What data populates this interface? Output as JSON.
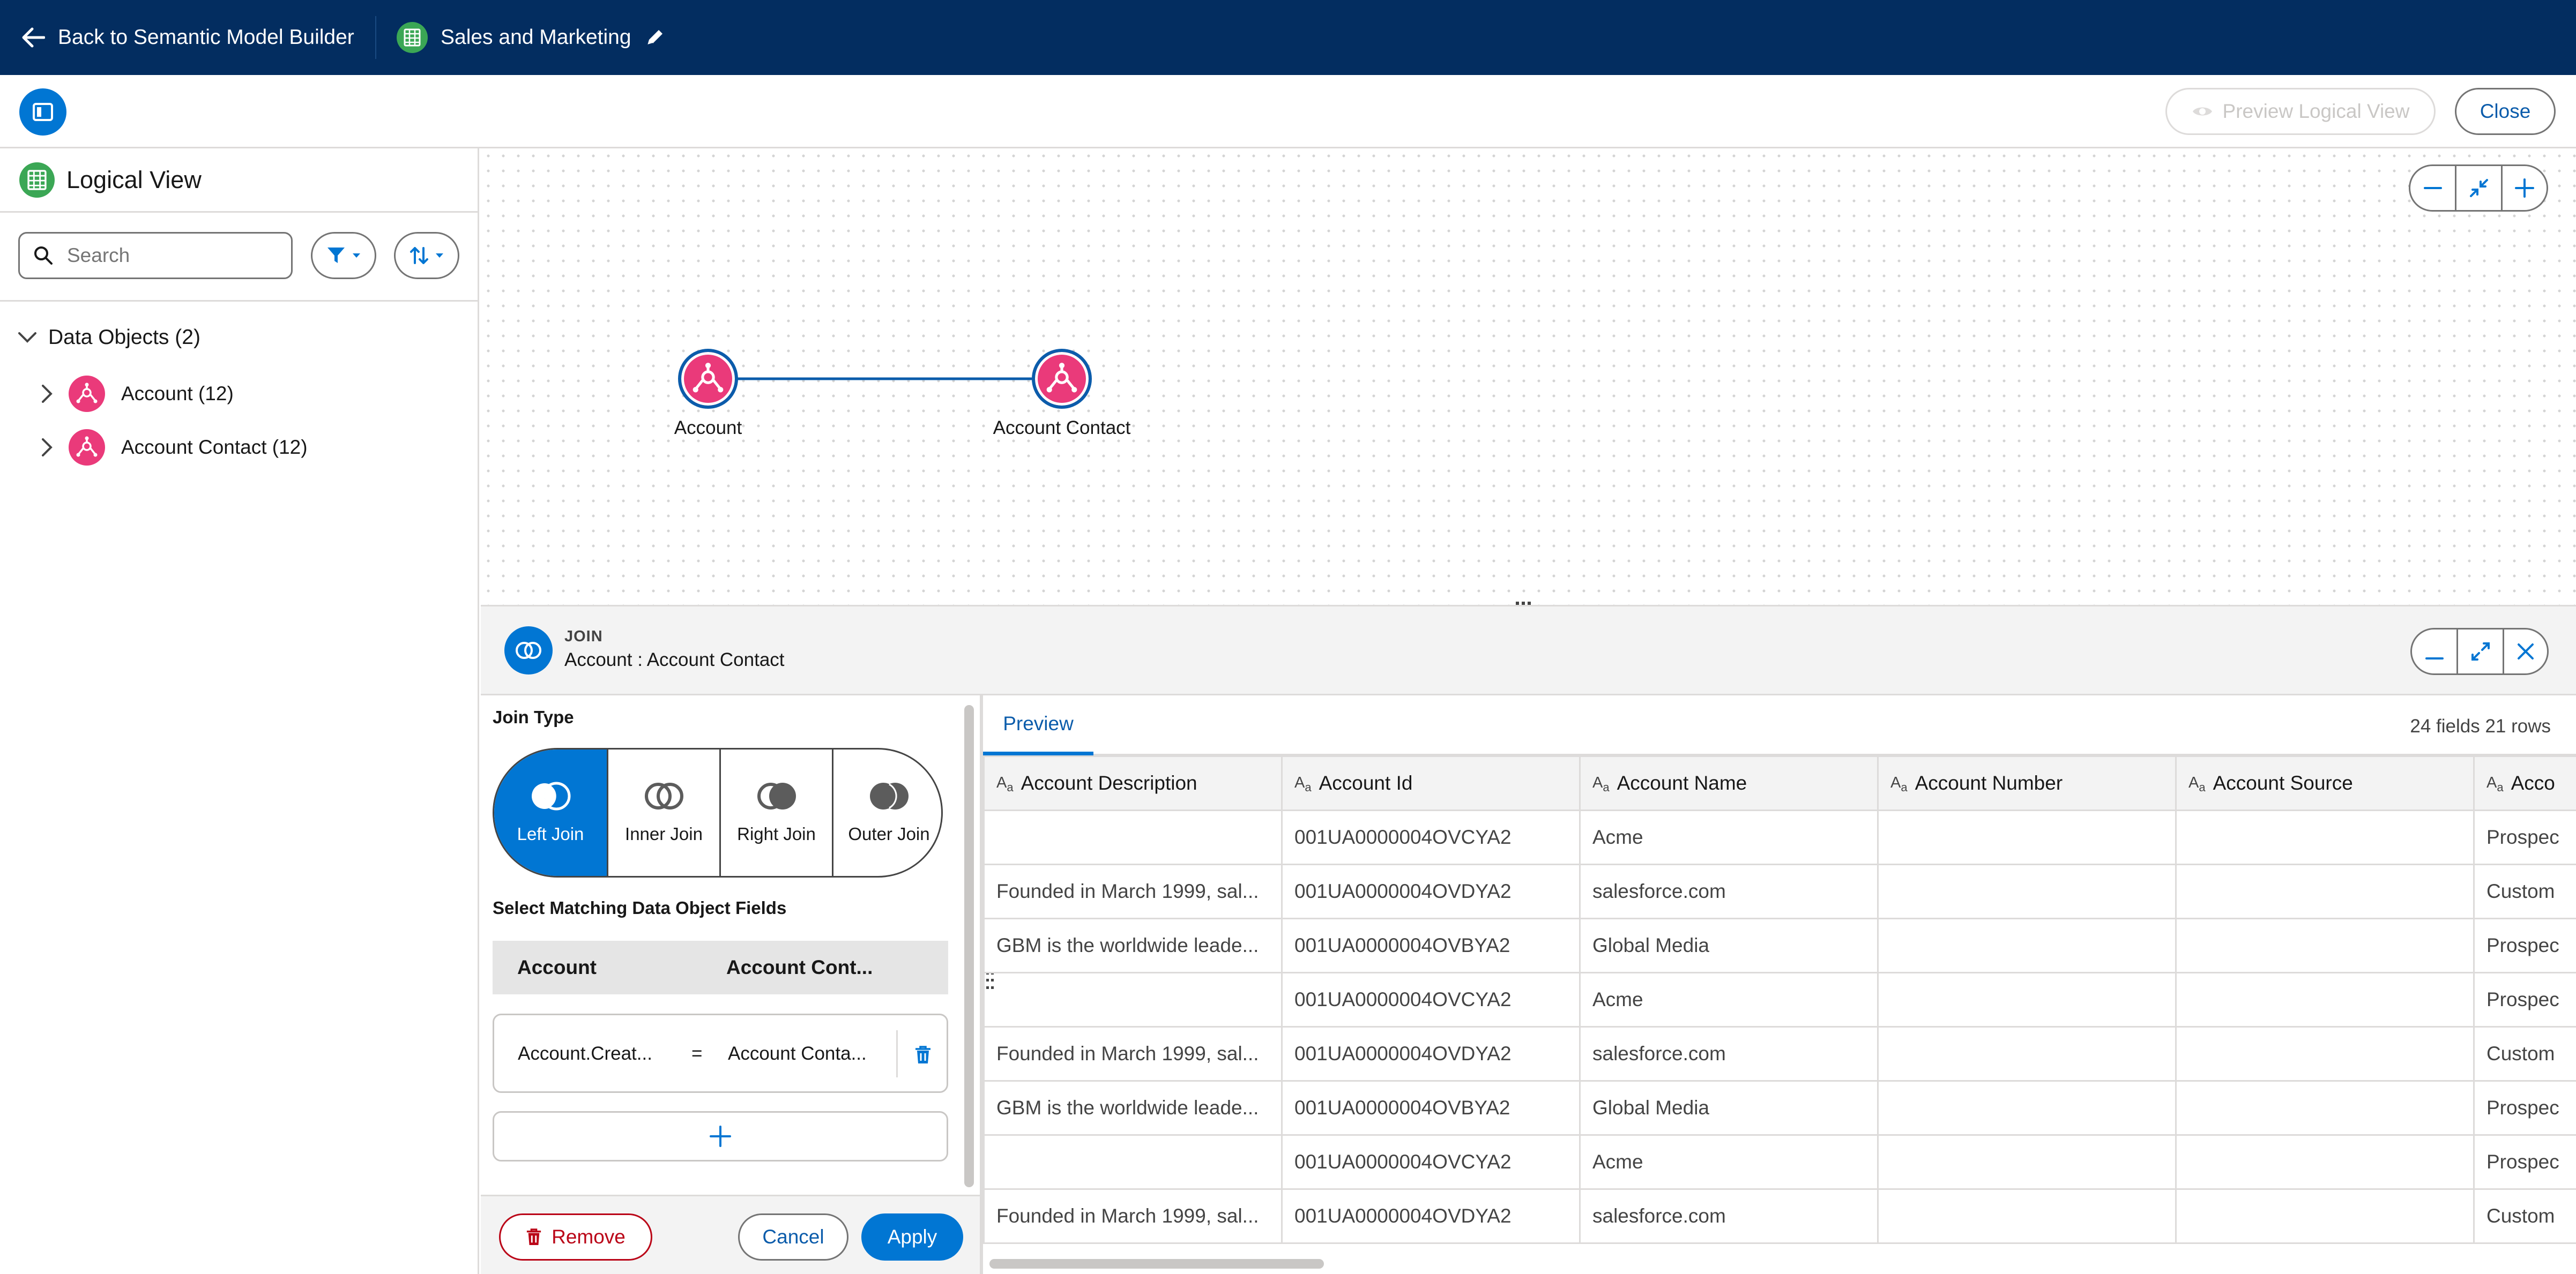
{
  "topbar": {
    "back_label": "Back to Semantic Model Builder",
    "model_title": "Sales and Marketing"
  },
  "toolbar": {
    "preview_label": "Preview Logical View",
    "close_label": "Close"
  },
  "left_panel": {
    "title": "Logical View",
    "search_placeholder": "Search",
    "section_label": "Data Objects (2)",
    "items": [
      {
        "label": "Account (12)"
      },
      {
        "label": "Account Contact (12)"
      }
    ]
  },
  "canvas": {
    "nodes": [
      {
        "label": "Account"
      },
      {
        "label": "Account Contact"
      }
    ]
  },
  "join": {
    "kicker": "JOIN",
    "subtitle": "Account : Account Contact",
    "type_label": "Join Type",
    "types": [
      {
        "label": "Left Join",
        "selected": true
      },
      {
        "label": "Inner Join",
        "selected": false
      },
      {
        "label": "Right Join",
        "selected": false
      },
      {
        "label": "Outer Join",
        "selected": false
      }
    ],
    "matching_label": "Select Matching Data Object Fields",
    "col_left": "Account",
    "col_right": "Account Cont...",
    "condition_left": "Account.Creat...",
    "condition_op": "=",
    "condition_right": "Account Conta...",
    "remove_label": "Remove",
    "cancel_label": "Cancel",
    "apply_label": "Apply"
  },
  "preview": {
    "tab_label": "Preview",
    "summary": "24 fields 21 rows",
    "columns": [
      "Account Description",
      "Account Id",
      "Account Name",
      "Account Number",
      "Account Source",
      "Acco"
    ],
    "rows": [
      [
        "",
        "001UA0000004OVCYA2",
        "Acme",
        "",
        "",
        "Prospec"
      ],
      [
        "Founded in March 1999, sal...",
        "001UA0000004OVDYA2",
        "salesforce.com",
        "",
        "",
        "Custom"
      ],
      [
        "GBM is the worldwide leade...",
        "001UA0000004OVBYA2",
        "Global Media",
        "",
        "",
        "Prospec"
      ],
      [
        "",
        "001UA0000004OVCYA2",
        "Acme",
        "",
        "",
        "Prospec"
      ],
      [
        "Founded in March 1999, sal...",
        "001UA0000004OVDYA2",
        "salesforce.com",
        "",
        "",
        "Custom"
      ],
      [
        "GBM is the worldwide leade...",
        "001UA0000004OVBYA2",
        "Global Media",
        "",
        "",
        "Prospec"
      ],
      [
        "",
        "001UA0000004OVCYA2",
        "Acme",
        "",
        "",
        "Prospec"
      ],
      [
        "Founded in March 1999, sal...",
        "001UA0000004OVDYA2",
        "salesforce.com",
        "",
        "",
        "Custom"
      ]
    ]
  },
  "colors": {
    "nav_bg": "#032d60",
    "brand_blue": "#0176d3",
    "node_pink": "#ea3a7a",
    "destructive": "#ba0517"
  }
}
